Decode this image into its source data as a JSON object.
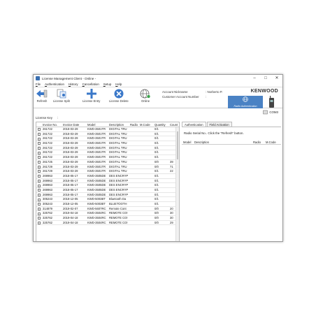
{
  "window": {
    "title": "License Management Client - Online -"
  },
  "menu": [
    {
      "pre": "",
      "u": "F",
      "post": "ile"
    },
    {
      "pre": "",
      "u": "A",
      "post": "uthentication"
    },
    {
      "pre": "",
      "u": "H",
      "post": "istory"
    },
    {
      "pre": "",
      "u": "C",
      "post": "ancellation"
    },
    {
      "pre": "",
      "u": "S",
      "post": "etup"
    },
    {
      "pre": "",
      "u": "H",
      "post": "elp"
    }
  ],
  "toolbar": {
    "refresh": "Refresh",
    "license_split": "License Split",
    "license_entry": "License Entry",
    "license_delete": "License Delete",
    "online": "Online"
  },
  "account": {
    "nickname_label": "Account Nickname",
    "nickname_value": ": Norberto P.",
    "number_label": "Customer Account Number",
    "number_value": ":"
  },
  "brand": "KENWOOD",
  "radio_auth_label": "Radio Authentication",
  "coms_label": "COM3",
  "license_key_label": "License Key",
  "license_key_value": ":",
  "columns": [
    "Invoice No.",
    "Invoice Date",
    "Model",
    "Description",
    "Radio",
    "M.Code",
    "Quantity",
    "Count"
  ],
  "rows": [
    [
      "261722",
      "2018-03-29",
      "KWD-3501TR",
      "DIGITAL TRU",
      "",
      "",
      "0/1",
      ""
    ],
    [
      "261722",
      "2018-03-29",
      "KWD-3501TR",
      "DIGITAL TRU",
      "",
      "",
      "0/1",
      ""
    ],
    [
      "261722",
      "2018-03-29",
      "KWD-3501TR",
      "DIGITAL TRU",
      "",
      "",
      "0/1",
      ""
    ],
    [
      "261722",
      "2018-03-29",
      "KWD-3501TR",
      "DIGITAL TRU",
      "",
      "",
      "0/1",
      ""
    ],
    [
      "261722",
      "2018-03-29",
      "KWD-3501TR",
      "DIGITAL TRU",
      "",
      "",
      "0/1",
      ""
    ],
    [
      "261722",
      "2018-03-29",
      "KWD-3501TR",
      "DIGITAL TRU",
      "",
      "",
      "0/1",
      ""
    ],
    [
      "261722",
      "2018-03-29",
      "KWD-3501TR",
      "DIGITAL TRU",
      "",
      "",
      "0/1",
      ""
    ],
    [
      "261725",
      "2018-03-29",
      "KWD-3501TR",
      "DIGITAL TRU",
      "",
      "",
      "0/0",
      "39"
    ],
    [
      "261729",
      "2018-03-29",
      "KWD-3501TR",
      "DIGITAL TRU",
      "",
      "",
      "0/0",
      "71"
    ],
    [
      "261729",
      "2018-03-29",
      "KWD-3501TR",
      "DIGITAL TRU",
      "",
      "",
      "0/1",
      "22"
    ],
    [
      "269963",
      "2018-05-17",
      "KWD-3505DE",
      "DES ENCRYP",
      "",
      "",
      "0/1",
      ""
    ],
    [
      "269963",
      "2018-05-17",
      "KWD-3505DE",
      "DES ENCRYP",
      "",
      "",
      "0/1",
      ""
    ],
    [
      "269963",
      "2018-05-17",
      "KWD-3505DE",
      "DES ENCRYP",
      "",
      "",
      "0/1",
      ""
    ],
    [
      "269963",
      "2018-05-17",
      "KWD-3505DE",
      "DES ENCRYP",
      "",
      "",
      "0/1",
      ""
    ],
    [
      "269963",
      "2018-05-17",
      "KWD-3505DE",
      "DES ENCRYP",
      "",
      "",
      "0/1",
      ""
    ],
    [
      "305243",
      "2018-12-05",
      "KWD-5003BT",
      "Bluetooth Da",
      "",
      "",
      "0/1",
      ""
    ],
    [
      "305243",
      "2018-12-05",
      "KWD-5003BT",
      "BLUETOOTH",
      "",
      "",
      "0/1",
      ""
    ],
    [
      "314879",
      "2019-02-07",
      "KWD-5607RC",
      "Remote Cont",
      "",
      "",
      "0/0",
      "20"
    ],
    [
      "325762",
      "2019-04-18",
      "KWD-3504RC",
      "REMOTE CO!",
      "",
      "",
      "0/0",
      "30"
    ],
    [
      "325762",
      "2019-04-18",
      "KWD-3504RC",
      "REMOTE CO!",
      "",
      "",
      "0/0",
      "30"
    ],
    [
      "325762",
      "2019-04-18",
      "KWD-3504RC",
      "REMOTE CO!",
      "",
      "",
      "0/0",
      "29"
    ]
  ],
  "right": {
    "tab_auth": "Authentication",
    "tab_field": "Field Activation",
    "hint": "Radio Serial No.. Click the \"Refresh\" button.",
    "columns": [
      "Model",
      "Description",
      "Radio",
      "M.Code"
    ]
  },
  "colors": {
    "accent": "#4a82c4",
    "icon_blue": "#3a78c9"
  }
}
